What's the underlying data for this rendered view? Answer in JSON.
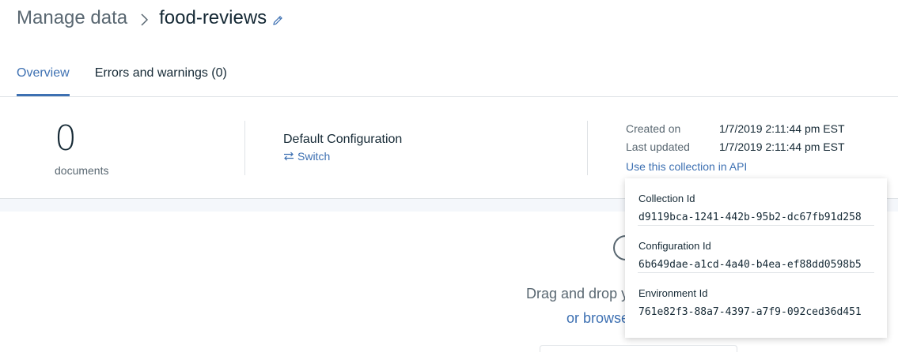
{
  "breadcrumb": {
    "parent": "Manage data",
    "current": "food-reviews"
  },
  "tabs": [
    {
      "label": "Overview",
      "active": true
    },
    {
      "label": "Errors and warnings (0)",
      "active": false
    }
  ],
  "summary": {
    "document_count": "0",
    "document_label": "documents",
    "configuration_name": "Default Configuration",
    "switch_label": "Switch",
    "created_on_label": "Created on",
    "created_on_value": "1/7/2019 2:11:44 pm EST",
    "last_updated_label": "Last updated",
    "last_updated_value": "1/7/2019 2:11:44 pm EST",
    "api_link": "Use this collection in API"
  },
  "api_popover": {
    "items": [
      {
        "label": "Collection Id",
        "value": "d9119bca-1241-442b-95b2-dc67fb91d258"
      },
      {
        "label": "Configuration Id",
        "value": "6b649dae-a1cd-4a40-b4ea-ef88dd0598b5"
      },
      {
        "label": "Environment Id",
        "value": "761e82f3-88a7-4397-a7f9-092ced36d451"
      }
    ]
  },
  "upload": {
    "drag_text": "Drag and drop y",
    "browse_text": "or browse"
  },
  "colors": {
    "accent": "#3d70b2",
    "text": "#152935",
    "muted": "#5a6872",
    "divider": "#dfe3e6"
  },
  "icons": {
    "breadcrumb_separator": "chevron-right-icon",
    "edit": "pencil-icon",
    "switch": "switch-arrows-icon",
    "upload": "upload-icon"
  }
}
